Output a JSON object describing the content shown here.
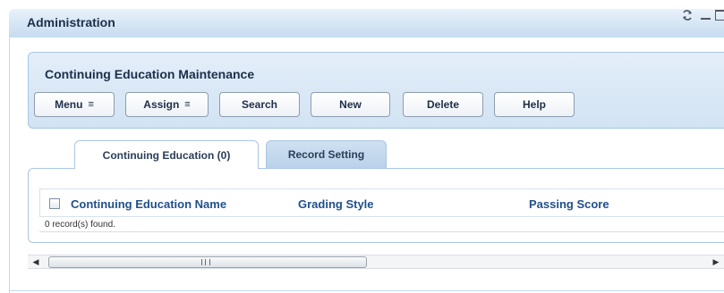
{
  "window": {
    "title": "Administration",
    "controls": [
      "refresh-icon",
      "minimize-icon",
      "maximize-icon"
    ]
  },
  "maintenance": {
    "title": "Continuing Education Maintenance",
    "buttons": {
      "menu": "Menu",
      "assign": "Assign",
      "search": "Search",
      "new": "New",
      "delete": "Delete",
      "help": "Help"
    }
  },
  "tabs": [
    {
      "label": "Continuing Education (0)",
      "active": true
    },
    {
      "label": "Record Setting",
      "active": false
    }
  ],
  "grid": {
    "columns": [
      "Continuing Education Name",
      "Grading Style",
      "Passing Score"
    ],
    "status": "0 record(s) found."
  },
  "scrollbar": {
    "grip_glyph": "III"
  },
  "colors": {
    "accent": "#21508a",
    "panel": "#d2e3f3",
    "border": "#a9c6e3"
  }
}
